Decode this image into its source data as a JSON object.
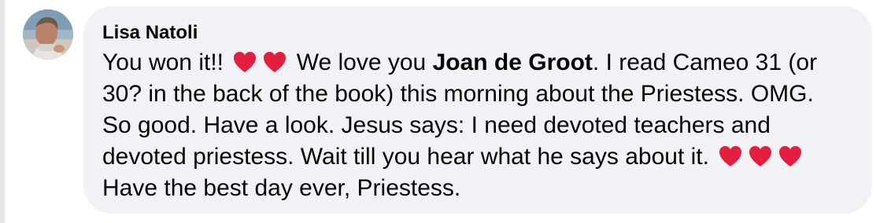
{
  "comment": {
    "author": "Lisa Natoli",
    "line1_a": "You won it!!",
    "line1_b": "We love you",
    "mention": "Joan de Groot",
    "line1_c": ". I read Cameo 31 (or",
    "line2": "30? in the back of the book) this morning about the Priestess. OMG.",
    "line3": "So good. Have a look. Jesus says: I need devoted teachers and",
    "line4": "devoted priestess. Wait till you hear what he says about it.",
    "line5": "Have the best day ever, Priestess.",
    "emoji": "red-heart",
    "heart_color": "#e41e3f",
    "bubble_color": "#f0f2f5",
    "text_color": "#050505"
  }
}
